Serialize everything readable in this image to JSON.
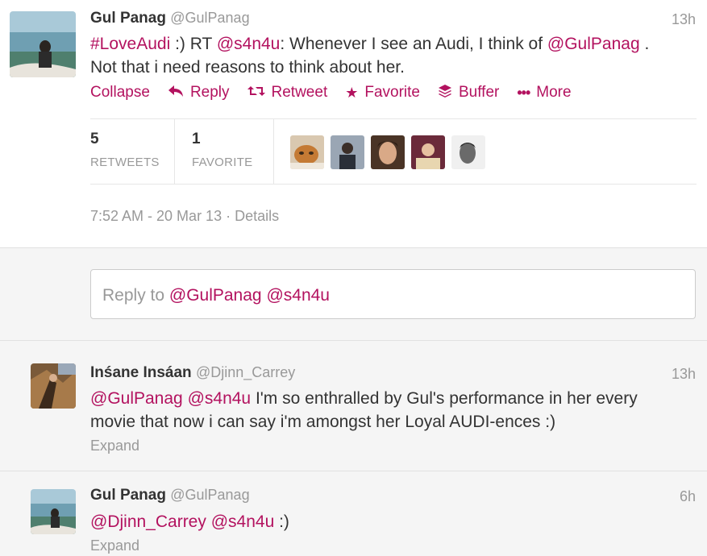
{
  "main_tweet": {
    "fullname": "Gul Panag",
    "screenname": "@GulPanag",
    "time": "13h",
    "text": {
      "hashtag": "#LoveAudi",
      "part1": " :) RT ",
      "mention1": "@s4n4u",
      "part2": ": Whenever I see an Audi, I think of ",
      "mention2": "@GulPanag",
      "part3": " .",
      "line2": "Not that i need reasons to think about her."
    },
    "actions": {
      "collapse": "Collapse",
      "reply": "Reply",
      "retweet": "Retweet",
      "favorite": "Favorite",
      "buffer": "Buffer",
      "more": "More"
    },
    "stats": {
      "retweets_count": "5",
      "retweets_label": "RETWEETS",
      "favorites_count": "1",
      "favorites_label": "FAVORITE"
    },
    "timestamp": "7:52 AM - 20 Mar 13",
    "details_sep": " · ",
    "details": "Details"
  },
  "reply_box": {
    "prefix": "Reply to ",
    "mention1": "@GulPanag",
    "mention2": "@s4n4u"
  },
  "replies": [
    {
      "fullname": "Inśane Insáan",
      "screenname": "@Djinn_Carrey",
      "time": "13h",
      "mention1": "@GulPanag",
      "mention2": "@s4n4u",
      "line1_rest": " I'm so enthralled by Gul's performance in her every",
      "line2": "movie that now i can say i'm amongst her Loyal AUDI-ences :)",
      "expand": "Expand"
    },
    {
      "fullname": "Gul Panag",
      "screenname": "@GulPanag",
      "time": "6h",
      "mention1": "@Djinn_Carrey",
      "mention2": "@s4n4u",
      "rest": " :)",
      "expand": "Expand"
    }
  ],
  "colors": {
    "link": "#b3125f",
    "muted": "#999999",
    "text": "#333333",
    "background_alt": "#f5f5f5"
  }
}
